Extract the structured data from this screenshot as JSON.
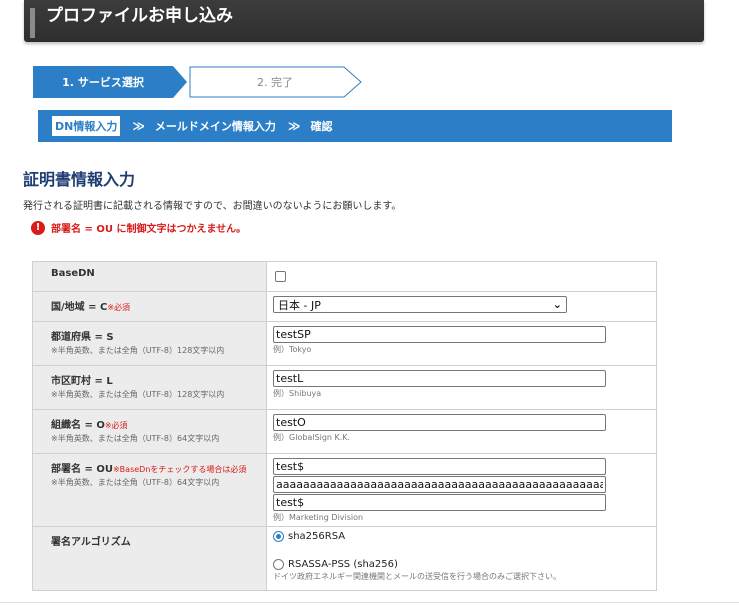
{
  "header": {
    "title": "プロファイルお申し込み"
  },
  "steps": [
    {
      "label": "1. サービス選択"
    },
    {
      "label": "2. 完了"
    }
  ],
  "subnav": {
    "items": [
      "DN情報入力",
      "メールドメイン情報入力",
      "確認"
    ],
    "separator": "≫"
  },
  "section": {
    "title": "証明書情報入力",
    "description": "発行される証明書に記載される情報ですので、お間違いのないようにお願いします。",
    "error": "部署名 = OU に制御文字はつかえません。",
    "error_icon": "!"
  },
  "form": {
    "basedn": {
      "label": "BaseDN"
    },
    "country": {
      "label": "国/地域 = C",
      "required": "※必須",
      "value": "日本 - JP",
      "chevron": "⌄"
    },
    "state": {
      "label": "都道府県 = S",
      "note": "※半角英数、または全角（UTF-8）128文字以内",
      "value": "testSP",
      "example": "例）Tokyo"
    },
    "locality": {
      "label": "市区町村 = L",
      "note": "※半角英数、または全角（UTF-8）128文字以内",
      "value": "testL",
      "example": "例）Shibuya"
    },
    "org": {
      "label": "組織名 = O",
      "required": "※必須",
      "note": "※半角英数、または全角（UTF-8）64文字以内",
      "value": "testO",
      "example": "例）GlobalSign K.K."
    },
    "ou": {
      "label": "部署名 = OU",
      "required": "※BaseDnをチェックする場合は必須",
      "note": "※半角英数、または全角（UTF-8）64文字以内",
      "values": [
        "test$",
        "aaaaaaaaaaaaaaaaaaaaaaaaaaaaaaaaaaaaaaaaaaaaaaaaaaaa",
        "test$"
      ],
      "example": "例）Marketing Division"
    },
    "algorithm": {
      "label": "署名アルゴリズム",
      "options": [
        {
          "label": "sha256RSA",
          "selected": true
        },
        {
          "label": "RSASSA-PSS (sha256)",
          "selected": false
        }
      ],
      "note": "ドイツ政府エネルギー関連機関とメールの送受信を行う場合のみご選択下さい。"
    }
  }
}
